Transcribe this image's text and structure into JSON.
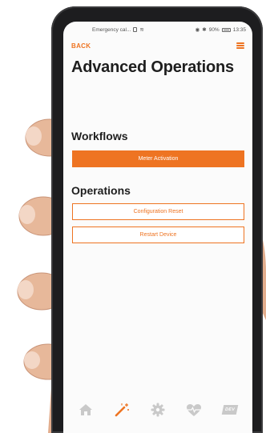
{
  "status_bar": {
    "carrier": "Emergency cal...",
    "battery_pct": "90%",
    "time": "13:35"
  },
  "header": {
    "back_label": "BACK",
    "title": "Advanced Operations"
  },
  "workflows": {
    "title": "Workflows",
    "buttons": [
      "Meter Activation"
    ]
  },
  "operations": {
    "title": "Operations",
    "buttons": [
      "Configuration Reset",
      "Restart Device"
    ]
  },
  "bottom_nav": {
    "items": [
      "home-icon",
      "magic-wand-icon",
      "gear-icon",
      "heart-pulse-icon",
      "dev-icon"
    ],
    "dev_label": "DEV",
    "active_index": 1
  },
  "colors": {
    "accent": "#ee7422",
    "inactive_icon": "#c9c9c9",
    "title_text": "#1e1e1e"
  }
}
